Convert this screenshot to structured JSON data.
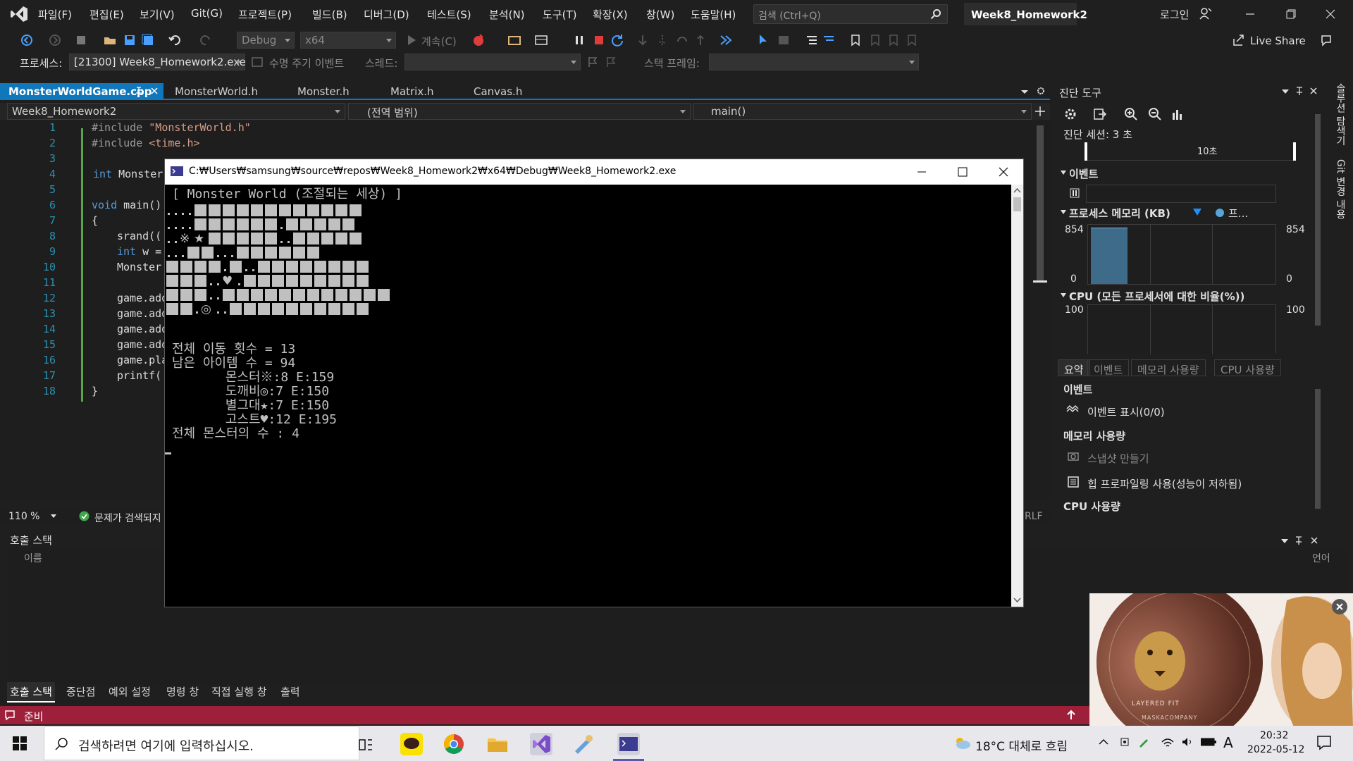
{
  "menu": {
    "items": [
      "파일(F)",
      "편집(E)",
      "보기(V)",
      "Git(G)",
      "프로젝트(P)",
      "빌드(B)",
      "디버그(D)",
      "테스트(S)",
      "분석(N)",
      "도구(T)",
      "확장(X)",
      "창(W)",
      "도움말(H)"
    ],
    "search_placeholder": "검색 (Ctrl+Q)",
    "solution": "Week8_Homework2",
    "login": "로그인"
  },
  "toolbar": {
    "continue_label": "계속(C)",
    "config": "Debug",
    "platform": "x64",
    "live_share": "Live Share",
    "process_label": "프로세스:",
    "process_value": "[21300] Week8_Homework2.exe",
    "lifecycle_label": "수명 주기 이벤트",
    "thread_label": "스레드:",
    "stackframe_label": "스택 프레임:"
  },
  "editor": {
    "tabs": [
      "MonsterWorldGame.cpp",
      "MonsterWorld.h",
      "Monster.h",
      "Matrix.h",
      "Canvas.h"
    ],
    "nav_project": "Week8_Homework2",
    "nav_scope": "(전역 범위)",
    "nav_member": "main()",
    "line_numbers": [
      "1",
      "2",
      "3",
      "4",
      "5",
      "6",
      "7",
      "8",
      "9",
      "10",
      "11",
      "12",
      "13",
      "14",
      "15",
      "16",
      "17",
      "18"
    ],
    "lines": {
      "l1_pp": "#include ",
      "l1_str": "\"MonsterWorld.h\"",
      "l2_pp": "#include ",
      "l2_str": "<time.h>",
      "l4_kw": "int",
      "l4_rest": " Monster",
      "l6_kw": "void",
      "l6_rest": " main()",
      "l7": "{",
      "l8": "srand((",
      "l9_kw": "int",
      "l9_rest": " w =",
      "l10": "Monster",
      "l12": "game.add",
      "l13": "game.add",
      "l14": "game.add",
      "l15": "game.add",
      "l16": "game.pla",
      "l17": "printf(",
      "l18": "}"
    },
    "zoom": "110 %",
    "issues": "문제가 검색되지",
    "eol": "RLF"
  },
  "console": {
    "title": "C:₩Users₩samsung₩source₩repos₩Week8_Homework2₩x64₩Debug₩Week8_Homework2.exe",
    "header": "[ Monster World (조절되는 세상) ]",
    "glyphs": {
      "kome": "※",
      "star": "★",
      "heart": "♥",
      "bullseye": "◎"
    },
    "stats": [
      "전체 이동 횟수 = 13",
      "남은 아이템 수 = 94",
      "       몬스터※:8 E:159",
      "       도깨비◎:7 E:150",
      "       별그대★:7 E:150",
      "       고스트♥:12 E:195",
      "전체 몬스터의 수 : 4"
    ]
  },
  "diagnostics": {
    "title": "진단 도구",
    "session": "진단 세션: 3 초",
    "time_mark": "10초",
    "events_header": "이벤트",
    "memory_header": "프로세스 메모리 (KB)",
    "memory_legend": "프...",
    "memory_max": "854",
    "memory_min": "0",
    "memory_level": 0.95,
    "cpu_header": "CPU (모든 프로세서에 대한 비율(%))",
    "cpu_max": "100",
    "tabs": [
      "요약",
      "이벤트",
      "메모리 사용량",
      "CPU 사용량"
    ],
    "section_events": "이벤트",
    "show_events": "이벤트 표시(0/0)",
    "section_memory": "메모리 사용량",
    "snapshot": "스냅샷 만들기",
    "heap_profiling": "힙 프로파일링 사용(성능이 저하됨)",
    "section_cpu": "CPU 사용량"
  },
  "side_strip": [
    "솔루션 탐색기",
    "Git 변경 내용"
  ],
  "bottom_panel": {
    "title": "호출 스택",
    "col_name": "이름",
    "col_lang": "언어",
    "tabs": [
      "호출 스택",
      "중단점",
      "예외 설정",
      "명령 창",
      "직접 실행 창",
      "출력"
    ]
  },
  "status": {
    "ready": "준비"
  },
  "ad": {
    "text": "LAYERED FIT",
    "subtext": "MASKACOMPANY"
  },
  "taskbar": {
    "search_placeholder": "검색하려면 여기에 입력하십시오.",
    "weather": "18°C  대체로 흐림",
    "time": "20:32",
    "date": "2022-05-12",
    "ime": "A"
  },
  "colors": {
    "accent": "#1177bb",
    "status_bar": "#9e1f3a",
    "vs_purple": "#a170e8"
  }
}
